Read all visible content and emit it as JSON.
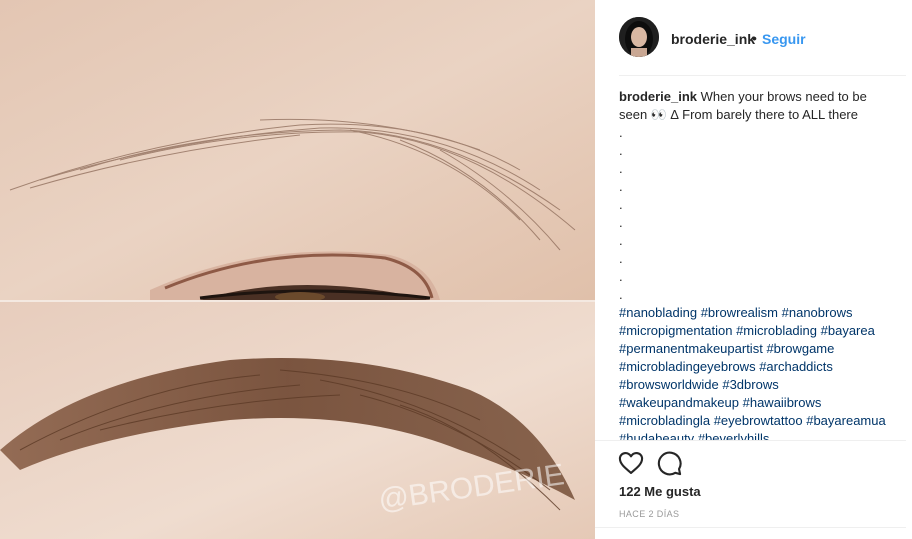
{
  "post": {
    "username": "broderie_ink",
    "separator": "•",
    "follow_label": "Seguir",
    "watermark": "@BRODERIE",
    "caption": {
      "user": "broderie_ink",
      "text": "When your brows need to be seen 👀 ∆ From barely there to ALL there",
      "dots": [
        ".",
        ".",
        ".",
        ".",
        ".",
        ".",
        ".",
        ".",
        ".",
        "."
      ],
      "hashtags": [
        "#nanoblading",
        "#browrealism",
        "#nanobrows",
        "#micropigmentation",
        "#microblading",
        "#bayarea",
        "#permanentmakeupartist",
        "#browgame",
        "#microbladingeyebrows",
        "#archaddicts",
        "#browsworldwide",
        "#3dbrows",
        "#wakeupandmakeup",
        "#hawaiibrows",
        "#microbladingla",
        "#eyebrowtattoo",
        "#bayareamua",
        "#hudabeauty",
        "#beverlyhills"
      ]
    },
    "likes_label": "122 Me gusta",
    "time_label": "HACE 2 DÍAS"
  },
  "icons": {
    "like": "heart-outline-icon",
    "comment": "speech-bubble-icon"
  },
  "colors": {
    "link_blue": "#3897f0",
    "hashtag_blue": "#003569",
    "muted": "#999999",
    "text": "#262626"
  }
}
